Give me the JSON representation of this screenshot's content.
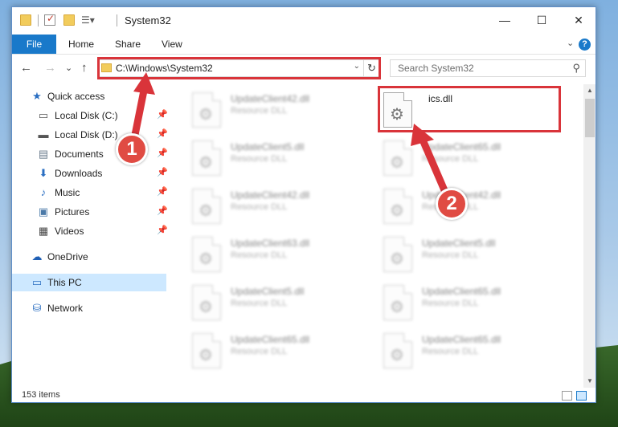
{
  "window": {
    "title": "System32",
    "controls": {
      "minimize": "—",
      "maximize": "☐",
      "close": "✕"
    }
  },
  "ribbon": {
    "file_tab": "File",
    "tabs": [
      "Home",
      "Share",
      "View"
    ],
    "help_label": "?"
  },
  "navigation": {
    "back_glyph": "←",
    "forward_glyph": "→",
    "recent_glyph": "⌄",
    "up_glyph": "↑"
  },
  "address_bar": {
    "path": "C:\\Windows\\System32",
    "dropdown_glyph": "⌄",
    "refresh_glyph": "↻"
  },
  "search": {
    "placeholder": "Search System32",
    "icon_glyph": "⚲"
  },
  "sidebar": {
    "items": [
      {
        "label": "Quick access",
        "icon": "star-icon",
        "glyph": "★",
        "color": "#2b6fc2",
        "pinned": false
      },
      {
        "label": "Local Disk (C:)",
        "icon": "drive-icon",
        "glyph": "▭",
        "color": "#555555",
        "pinned": true
      },
      {
        "label": "Local Disk (D:)",
        "icon": "drive-icon",
        "glyph": "▬",
        "color": "#555555",
        "pinned": true
      },
      {
        "label": "Documents",
        "icon": "documents-icon",
        "glyph": "▤",
        "color": "#6a7b8c",
        "pinned": true
      },
      {
        "label": "Downloads",
        "icon": "downloads-icon",
        "glyph": "⬇",
        "color": "#2b6fc2",
        "pinned": true
      },
      {
        "label": "Music",
        "icon": "music-icon",
        "glyph": "♪",
        "color": "#2b6fc2",
        "pinned": true
      },
      {
        "label": "Pictures",
        "icon": "pictures-icon",
        "glyph": "▣",
        "color": "#4b7aa8",
        "pinned": true
      },
      {
        "label": "Videos",
        "icon": "videos-icon",
        "glyph": "▦",
        "color": "#444444",
        "pinned": true
      },
      {
        "label": "OneDrive",
        "icon": "onedrive-icon",
        "glyph": "☁",
        "color": "#1f5fb5",
        "pinned": false
      },
      {
        "label": "This PC",
        "icon": "computer-icon",
        "glyph": "▭",
        "color": "#2b6fc2",
        "pinned": false,
        "selected": true
      },
      {
        "label": "Network",
        "icon": "network-icon",
        "glyph": "⛁",
        "color": "#2b6fc2",
        "pinned": false
      }
    ],
    "pin_glyph": "📌"
  },
  "files": {
    "left_column": [
      {
        "name": "UpdateClient42.dll",
        "type": "Resource DLL"
      },
      {
        "name": "UpdateClient5.dll",
        "type": "Resource DLL"
      },
      {
        "name": "UpdateClient42.dll",
        "type": "Resource DLL"
      },
      {
        "name": "UpdateClient63.dll",
        "type": "Resource DLL"
      },
      {
        "name": "UpdateClient5.dll",
        "type": "Resource DLL"
      },
      {
        "name": "UpdateClient65.dll",
        "type": "Resource DLL"
      }
    ],
    "right_column": [
      {
        "name": "ics.dll",
        "type": "",
        "highlighted": true
      },
      {
        "name": "UpdateClient65.dll",
        "type": "Resource DLL"
      },
      {
        "name": "UpdateClient42.dll",
        "type": "Resource DLL"
      },
      {
        "name": "UpdateClient5.dll",
        "type": "Resource DLL"
      },
      {
        "name": "UpdateClient65.dll",
        "type": "Resource DLL"
      },
      {
        "name": "UpdateClient65.dll",
        "type": "Resource DLL"
      }
    ],
    "gear_glyph": "⚙"
  },
  "status": {
    "item_count": "153 items"
  },
  "annotations": {
    "callout_1": "1",
    "callout_2": "2",
    "highlight_color": "#d9343a"
  }
}
